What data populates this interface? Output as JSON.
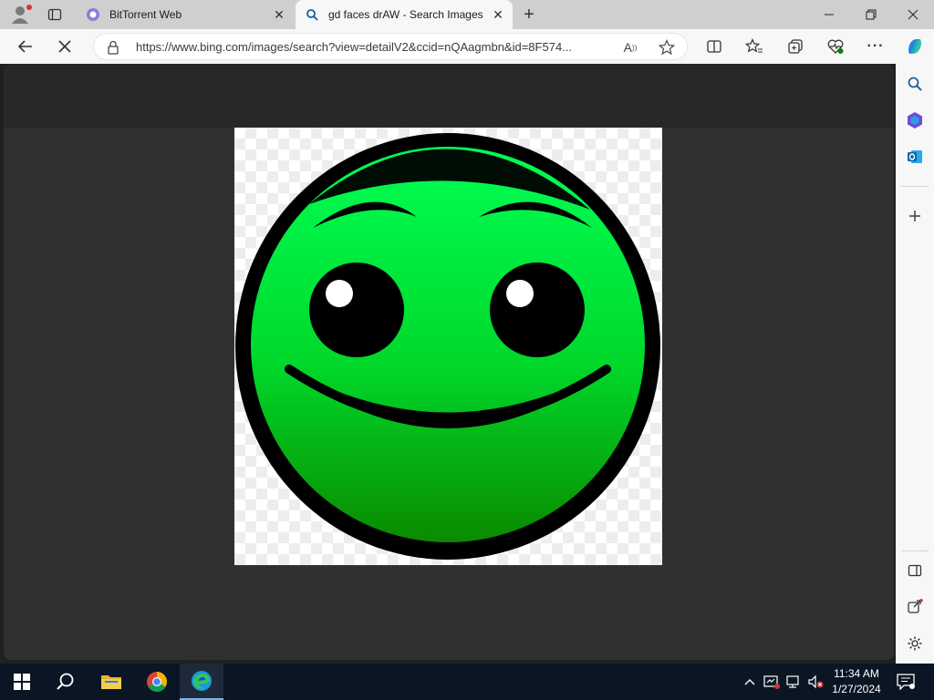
{
  "browser": {
    "tabs": [
      {
        "title": "BitTorrent Web",
        "active": false
      },
      {
        "title": "gd faces drAW - Search Images",
        "active": true
      }
    ],
    "address_bar": {
      "url": "https://www.bing.com/images/search?view=detailV2&ccid=nQAagmbn&id=8F574..."
    }
  },
  "content": {
    "image_subject": "green smiley face"
  },
  "taskbar": {
    "apps": [
      "start-icon",
      "search-icon",
      "file-explorer-icon",
      "chrome-icon",
      "edge-icon"
    ],
    "clock": {
      "time": "11:34 AM",
      "date": "1/27/2024"
    }
  },
  "colors": {
    "face_green_top": "#00ff55",
    "face_green_bottom": "#0a8a00",
    "outline": "#000000",
    "accent": "#0078d4"
  }
}
